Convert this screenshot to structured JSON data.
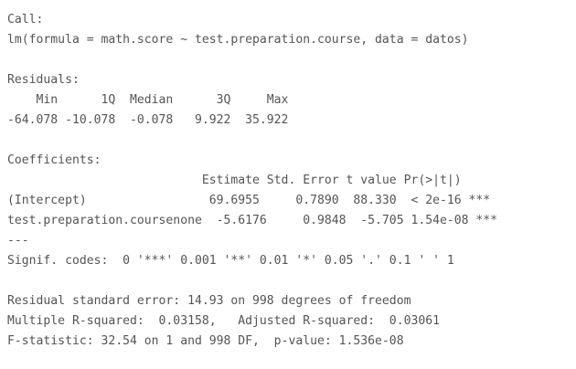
{
  "output": {
    "call_header": "Call:",
    "call_line": "lm(formula = math.score ~ test.preparation.course, data = datos)",
    "residuals_header": "Residuals:",
    "residuals_labels": "    Min      1Q  Median      3Q     Max ",
    "residuals_values": "-64.078 -10.078  -0.078   9.922  35.922 ",
    "coefficients_header": "Coefficients:",
    "coef_columns": "                           Estimate Std. Error t value Pr(>|t|)    ",
    "coef_row_intercept": "(Intercept)                 69.6955     0.7890  88.330  < 2e-16 ***",
    "coef_row_course": "test.preparation.coursenone  -5.6176     0.9848  -5.705 1.54e-08 ***",
    "separator": "---",
    "signif_codes": "Signif. codes:  0 '***' 0.001 '**' 0.01 '*' 0.05 '.' 0.1 ' ' 1",
    "residual_se": "Residual standard error: 14.93 on 998 degrees of freedom",
    "r_squared": "Multiple R-squared:  0.03158,\tAdjusted R-squared:  0.03061 ",
    "f_statistic": "F-statistic: 32.54 on 1 and 998 DF,  p-value: 1.536e-08"
  }
}
